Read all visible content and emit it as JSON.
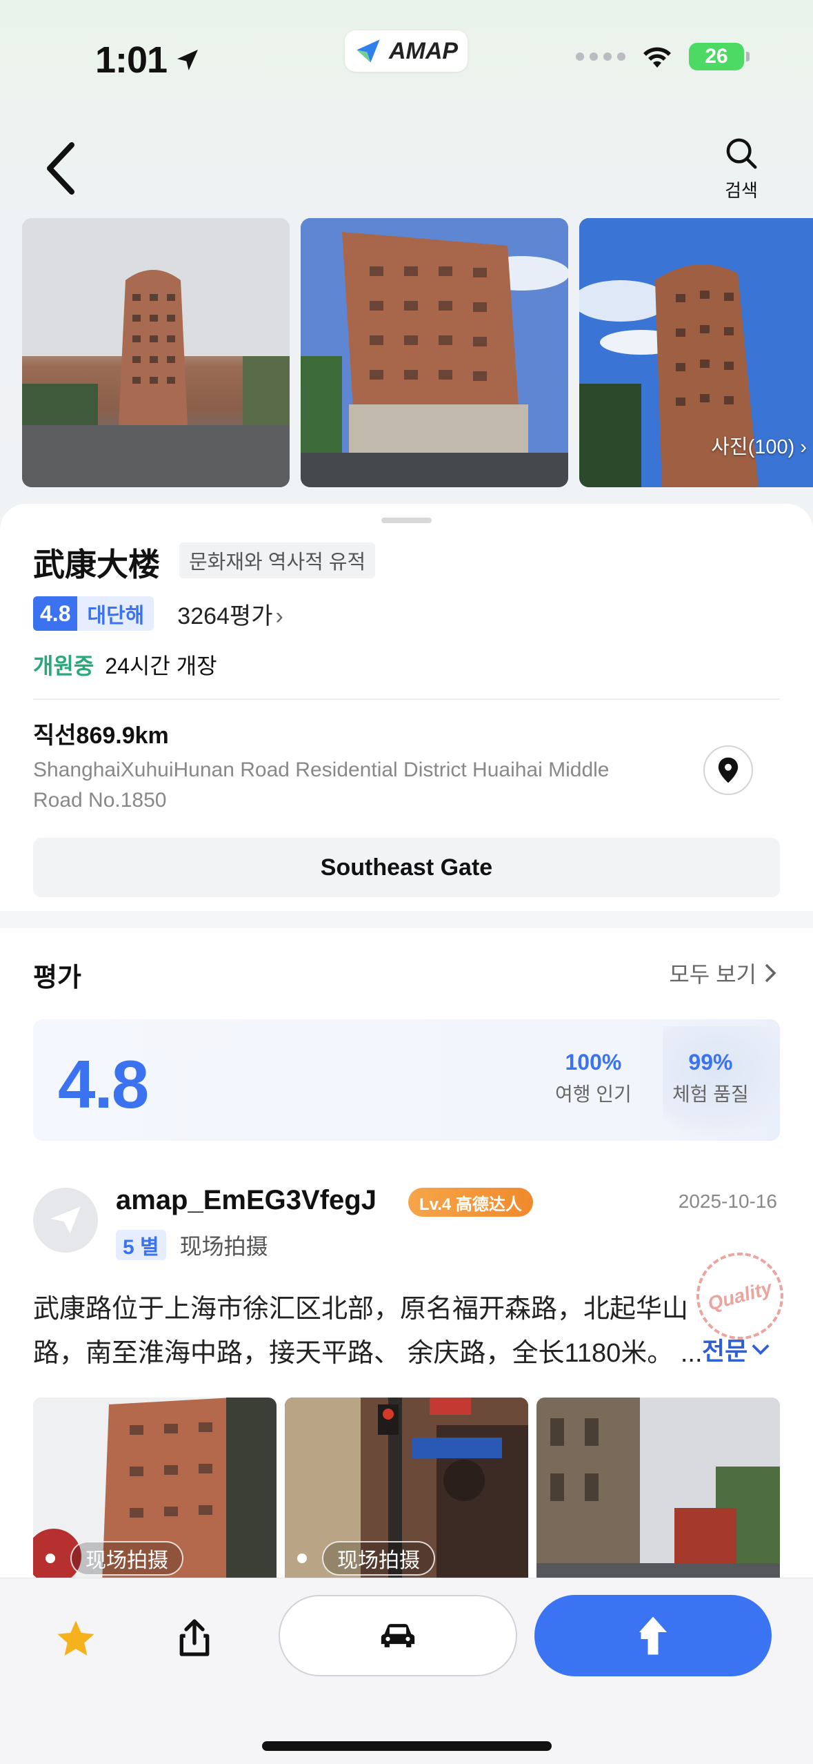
{
  "status_bar": {
    "time": "1:01",
    "app_badge": "AMAP",
    "battery": "26"
  },
  "header": {
    "search_label": "검색"
  },
  "photos": {
    "count_label": "사진(100) ›"
  },
  "poi": {
    "name": "武康大楼",
    "category": "문화재와 역사적 유적",
    "rating": "4.8",
    "rating_word": "대단해",
    "review_count": "3264평가",
    "open_status": "개원중",
    "open_hours": "24시간 개장",
    "distance": "직선869.9km",
    "address": "ShanghaiXuhuiHunan Road Residential District Huaihai Middle Road No.1850",
    "gate_button": "Southeast Gate"
  },
  "reviews": {
    "title": "평가",
    "view_all": "모두 보기",
    "score": "4.8",
    "metrics": [
      {
        "pct": "100%",
        "label": "여행 인기"
      },
      {
        "pct": "99%",
        "label": "체험 품질"
      }
    ],
    "items": [
      {
        "user": "amap_EmEG3VfegJ",
        "level": "Lv.4 高德达人",
        "date": "2025-10-16",
        "stars": "5 별",
        "tag": "现场拍摄",
        "text": "武康路位于上海市徐汇区北部，原名福开森路，北起华山路，南至淮海中路，接天平路、 余庆路，全长1180米。 ...",
        "expand_label": "전문",
        "stamp": "Quality",
        "photo_tags": [
          "现场拍摄",
          "现场拍摄"
        ]
      }
    ]
  },
  "colors": {
    "accent": "#3a72f0",
    "open_green": "#2aa87a",
    "badge_orange": "#f08a2c",
    "star": "#f5b21c"
  },
  "icons": [
    "location-arrow-icon",
    "wifi-icon",
    "back-chevron-icon",
    "search-icon",
    "pin-icon",
    "star-icon",
    "share-icon",
    "car-icon",
    "navigate-arrow-icon",
    "paper-plane-icon"
  ]
}
